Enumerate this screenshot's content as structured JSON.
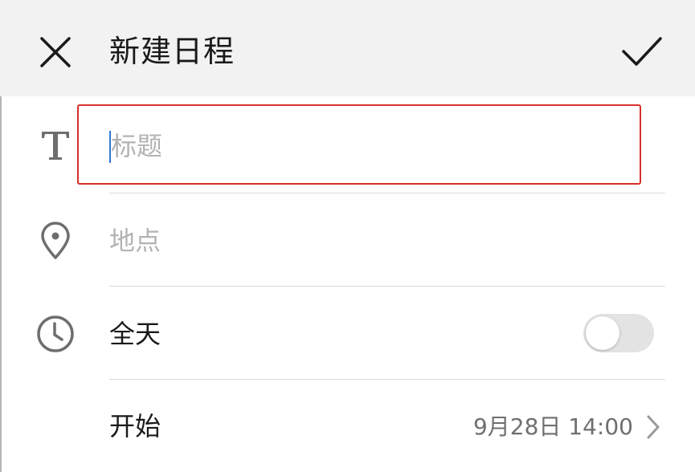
{
  "header": {
    "title": "新建日程",
    "close_icon": "close-icon",
    "confirm_icon": "check-icon"
  },
  "form": {
    "title_field": {
      "placeholder": "标题",
      "value": "",
      "icon": "text-icon"
    },
    "location_field": {
      "placeholder": "地点",
      "icon": "location-pin-icon"
    },
    "all_day": {
      "label": "全天",
      "enabled": false,
      "icon": "clock-icon"
    },
    "start": {
      "label": "开始",
      "value": "9月28日 14:00",
      "icon": "chevron-right-icon"
    }
  },
  "colors": {
    "header_bg": "#f2f2f2",
    "highlight_border": "#d9302b",
    "caret": "#2e7bd6",
    "placeholder": "#b3b3b3"
  }
}
